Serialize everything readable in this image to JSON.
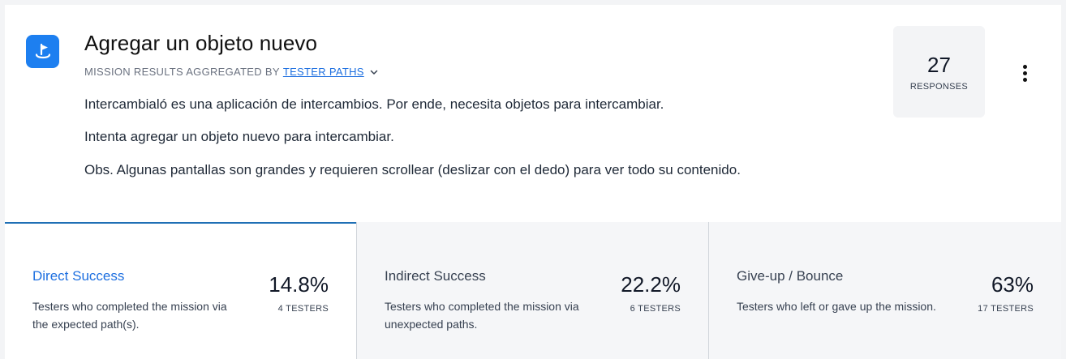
{
  "mission": {
    "icon": "flag-pin-icon",
    "title": "Agregar un objeto nuevo",
    "aggregated_prefix": "MISSION RESULTS AGGREGATED BY",
    "aggregated_by": "TESTER PATHS",
    "description": [
      "Intercambialó es una aplicación de intercambios. Por ende, necesita objetos para intercambiar.",
      "Intenta agregar un objeto nuevo para intercambiar.",
      "Obs. Algunas pantallas son grandes y requieren scrollear (deslizar con el dedo) para ver todo su contenido."
    ]
  },
  "responses": {
    "count": "27",
    "label": "RESPONSES"
  },
  "menu_icon": "more-vertical-icon",
  "stats": [
    {
      "title": "Direct Success",
      "description": "Testers who completed the mission via the expected path(s).",
      "percent": "14.8%",
      "testers": "4 TESTERS"
    },
    {
      "title": "Indirect Success",
      "description": "Testers who completed the mission via unexpected paths.",
      "percent": "22.2%",
      "testers": "6 TESTERS"
    },
    {
      "title": "Give-up / Bounce",
      "description": "Testers who left or gave up the mission.",
      "percent": "63%",
      "testers": "17 TESTERS"
    }
  ],
  "colors": {
    "accent": "#1d7ff0",
    "link": "#1d6fe0",
    "active_tab_border": "#1f6fb5"
  }
}
